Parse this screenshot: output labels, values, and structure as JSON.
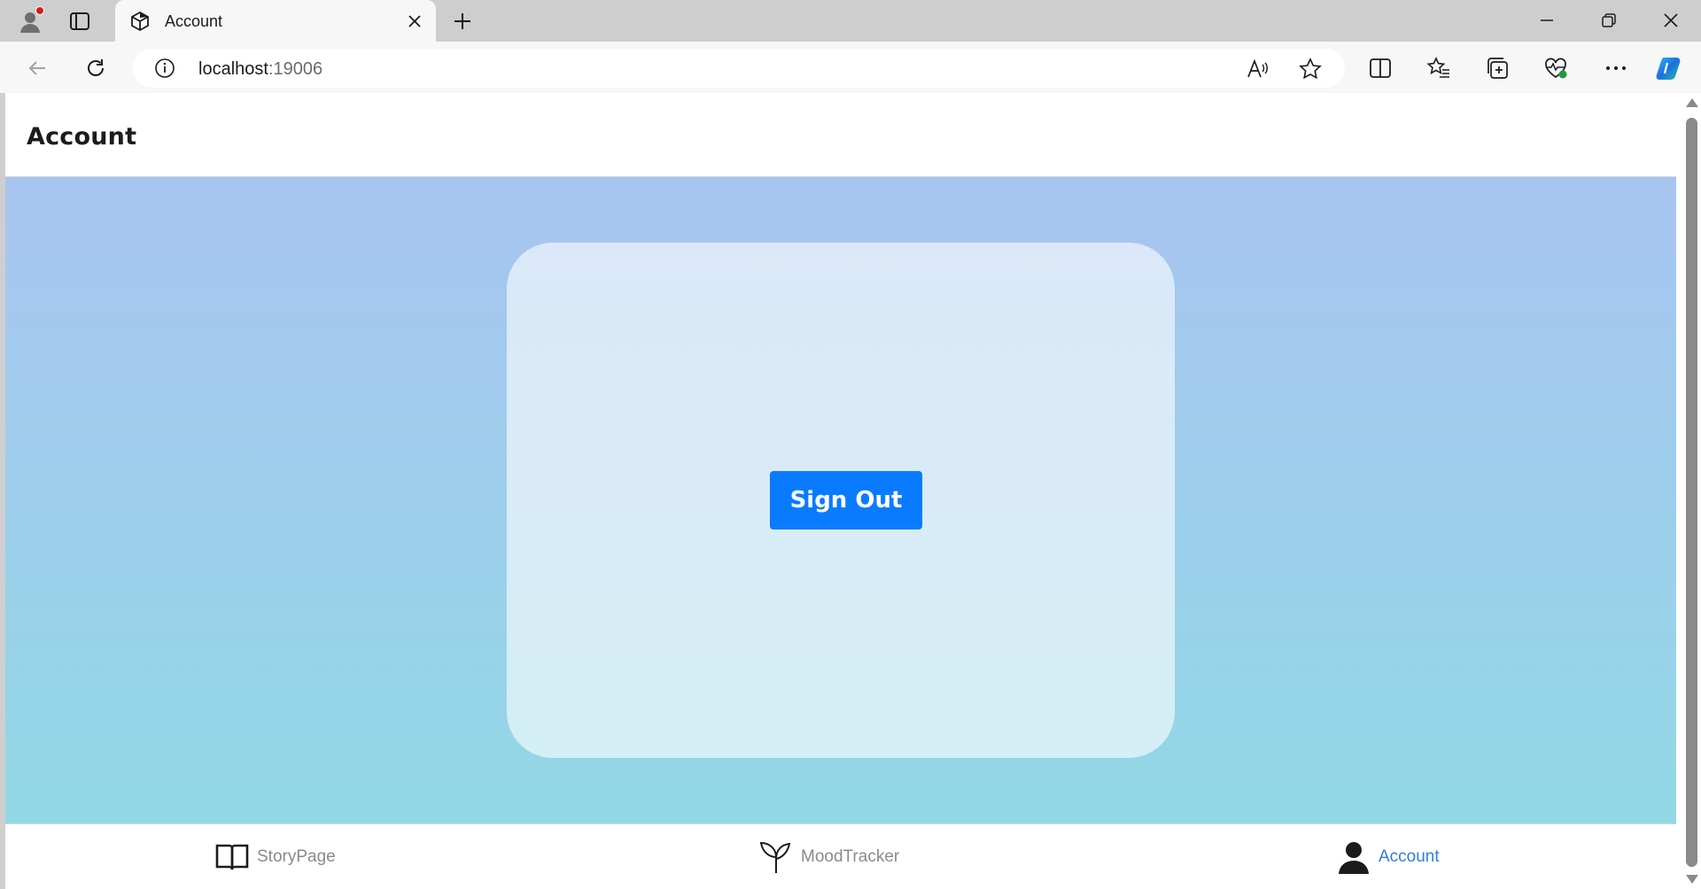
{
  "browser": {
    "tab": {
      "title": "Account",
      "favicon": "package-icon"
    },
    "address_bar": {
      "host": "localhost",
      "port": ":19006"
    },
    "icons": {
      "profile": "profile-avatar-icon",
      "tab_actions": "tab-actions-icon",
      "close_tab": "close-icon",
      "new_tab": "plus-icon",
      "back": "back-arrow-icon",
      "refresh": "refresh-icon",
      "site_info": "info-icon",
      "read_aloud": "read-aloud-icon",
      "favorite": "star-icon",
      "split_screen": "split-screen-icon",
      "favorites": "favorites-icon",
      "collections": "collections-icon",
      "browser_essentials": "heart-pulse-icon",
      "more": "more-icon",
      "copilot": "copilot-icon",
      "minimize": "minimize-icon",
      "restore": "restore-icon",
      "close_window": "close-window-icon"
    }
  },
  "app": {
    "header": {
      "title": "Account"
    },
    "card": {
      "sign_out_label": "Sign Out"
    },
    "bottom_nav": {
      "items": [
        {
          "label": "StoryPage",
          "icon": "book-open-icon",
          "active": false
        },
        {
          "label": "MoodTracker",
          "icon": "sprout-icon",
          "active": false
        },
        {
          "label": "Account",
          "icon": "person-icon",
          "active": true
        }
      ]
    }
  },
  "colors": {
    "primary_button": "#0a7bff",
    "active_nav": "#2f7de1",
    "inactive_nav": "#8a8a8a",
    "gradient_top": "#a8c4f1",
    "gradient_bottom": "#92d8e5"
  }
}
